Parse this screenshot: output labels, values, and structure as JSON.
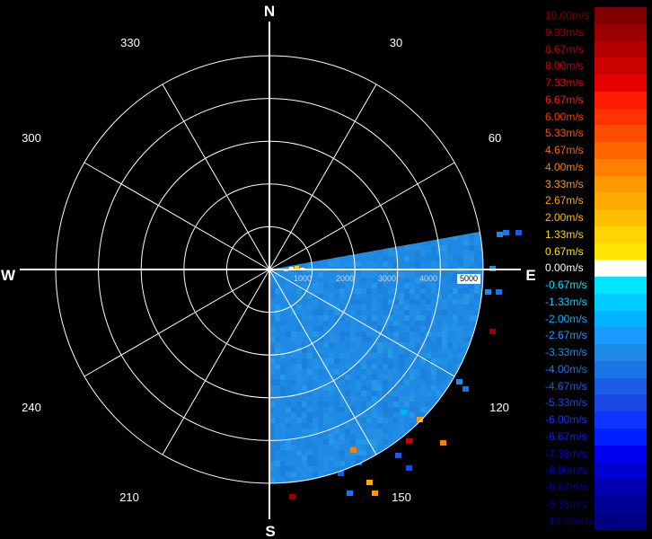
{
  "chart_data": {
    "type": "polar-radar-velocity",
    "title": "",
    "cardinals": [
      "N",
      "E",
      "S",
      "W"
    ],
    "angle_labels": [
      "30",
      "60",
      "120",
      "150",
      "210",
      "240",
      "300",
      "330"
    ],
    "range_labels": [
      "1000",
      "2000",
      "3000",
      "4000",
      "5000"
    ],
    "range_max": 5000,
    "ring_step": 1000,
    "data_sector_deg": [
      75,
      180
    ],
    "dominant_velocity": "-3.33m/s",
    "legend": [
      {
        "label": "10.00m/s",
        "color": "#800000"
      },
      {
        "label": "9.33m/s",
        "color": "#990000"
      },
      {
        "label": "8.67m/s",
        "color": "#b30000"
      },
      {
        "label": "8.00m/s",
        "color": "#cc0000"
      },
      {
        "label": "7.33m/s",
        "color": "#e60000"
      },
      {
        "label": "6.67m/s",
        "color": "#ff1a00"
      },
      {
        "label": "6.00m/s",
        "color": "#ff3300"
      },
      {
        "label": "5.33m/s",
        "color": "#ff4d00"
      },
      {
        "label": "4.67m/s",
        "color": "#ff6600"
      },
      {
        "label": "4.00m/s",
        "color": "#ff7f00"
      },
      {
        "label": "3.33m/s",
        "color": "#ff9900"
      },
      {
        "label": "2.67m/s",
        "color": "#ffaa00"
      },
      {
        "label": "2.00m/s",
        "color": "#ffbf00"
      },
      {
        "label": "1.33m/s",
        "color": "#ffd400"
      },
      {
        "label": "0.67m/s",
        "color": "#ffe600"
      },
      {
        "label": "0.00m/s",
        "color": "#ffffff"
      },
      {
        "label": "-0.67m/s",
        "color": "#00e5ff"
      },
      {
        "label": "-1.33m/s",
        "color": "#00ccff"
      },
      {
        "label": "-2.00m/s",
        "color": "#00b3ff"
      },
      {
        "label": "-2.67m/s",
        "color": "#1a99ff"
      },
      {
        "label": "-3.33m/s",
        "color": "#1f8ae6"
      },
      {
        "label": "-4.00m/s",
        "color": "#1a75e6"
      },
      {
        "label": "-4.67m/s",
        "color": "#1a5ce6"
      },
      {
        "label": "-5.33m/s",
        "color": "#1a47e6"
      },
      {
        "label": "-6.00m/s",
        "color": "#0d33ff"
      },
      {
        "label": "-6.67m/s",
        "color": "#0020ff"
      },
      {
        "label": "-7.33m/s",
        "color": "#0000f0"
      },
      {
        "label": "-8.00m/s",
        "color": "#0000d0"
      },
      {
        "label": "-8.67m/s",
        "color": "#0000b0"
      },
      {
        "label": "-9.33m/s",
        "color": "#000095"
      },
      {
        "label": "-10.00m/s",
        "color": "#000080"
      }
    ]
  }
}
